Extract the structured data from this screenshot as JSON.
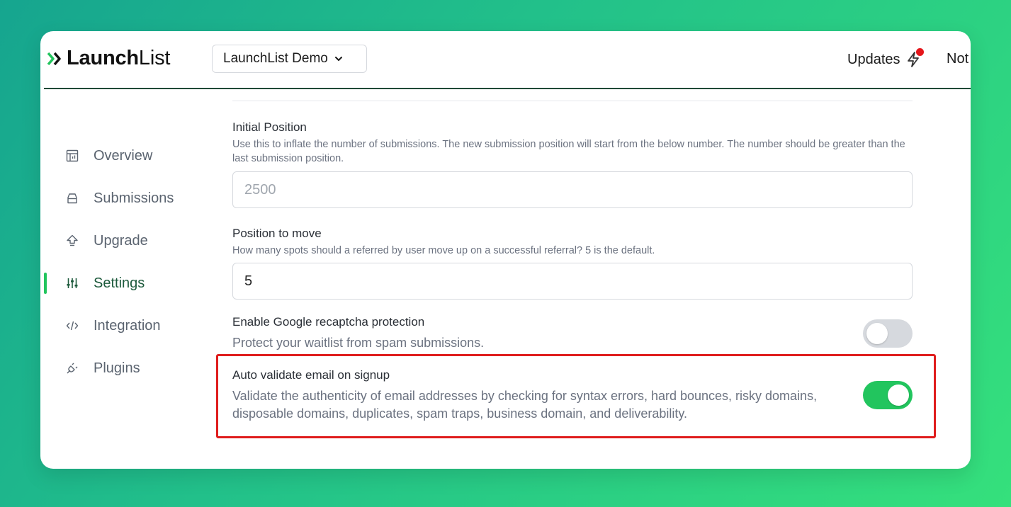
{
  "header": {
    "logo_bold": "Launch",
    "logo_light": "List",
    "project_label": "LaunchList Demo",
    "updates_label": "Updates",
    "notifications_label": "Not"
  },
  "sidebar": {
    "items": [
      {
        "label": "Overview",
        "icon": "chart-icon"
      },
      {
        "label": "Submissions",
        "icon": "inbox-icon"
      },
      {
        "label": "Upgrade",
        "icon": "upgrade-icon"
      },
      {
        "label": "Settings",
        "icon": "sliders-icon",
        "active": true
      },
      {
        "label": "Integration",
        "icon": "code-icon"
      },
      {
        "label": "Plugins",
        "icon": "plug-icon"
      }
    ]
  },
  "settings": {
    "initial_position": {
      "label": "Initial Position",
      "help": "Use this to inflate the number of submissions. The new submission position will start from the below number. The number should be greater than the last submission position.",
      "placeholder": "2500"
    },
    "position_to_move": {
      "label": "Position to move",
      "help": "How many spots should a referred by user move up on a successful referral? 5 is the default.",
      "value": "5"
    },
    "recaptcha": {
      "label": "Enable Google recaptcha protection",
      "description": "Protect your waitlist from spam submissions.",
      "enabled": false
    },
    "auto_validate": {
      "label": "Auto validate email on signup",
      "description": "Validate the authenticity of email addresses by checking for syntax errors, hard bounces, risky domains, disposable domains, duplicates, spam traps, business domain, and deliverability.",
      "enabled": true
    }
  },
  "colors": {
    "accent": "#22c55e",
    "active_nav": "#1d5a3c",
    "highlight": "#df1d1d",
    "notification_dot": "#e5161b"
  }
}
